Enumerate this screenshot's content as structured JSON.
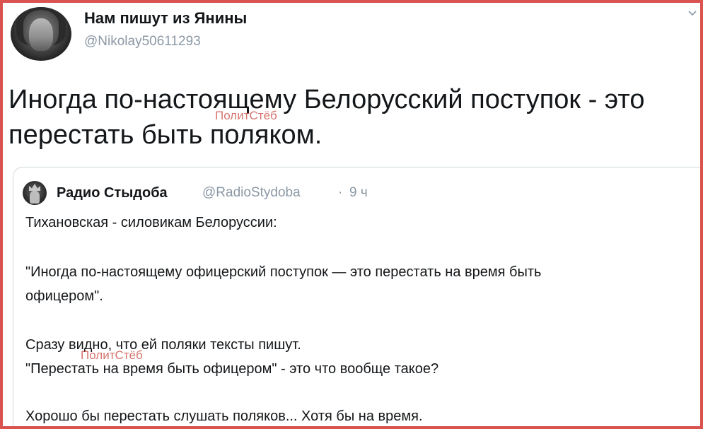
{
  "tweet": {
    "author_name": "Нам пишут из Янины",
    "author_handle": "@Nikolay50611293",
    "text": "Иногда по-настоящему Белорусский поступок - это перестать быть поляком.",
    "menu_icon": "chevron-down-icon"
  },
  "quoted_tweet": {
    "author_name": "Радио Стыдоба",
    "author_handle": "@RadioStydoba",
    "separator": "·",
    "time": "9 ч",
    "lines": [
      "Тихановская - силовикам Белоруссии:",
      "\"Иногда по-настоящему офицерский поступок — это перестать на время быть",
      "офицером\".",
      "Сразу видно, что ей поляки тексты пишут.",
      "\"Перестать на время быть офицером\" - это что вообще такое?",
      "Хорошо бы перестать слушать поляков... Хотя бы на время."
    ]
  },
  "watermarks": [
    "ПолитСтёб",
    "ПолитСтёб"
  ],
  "colors": {
    "frame_border": "#d9534f",
    "text": "#14171a",
    "secondary_text": "#8b98a5",
    "card_border": "#cfd9de",
    "watermark": "#c8463c"
  }
}
